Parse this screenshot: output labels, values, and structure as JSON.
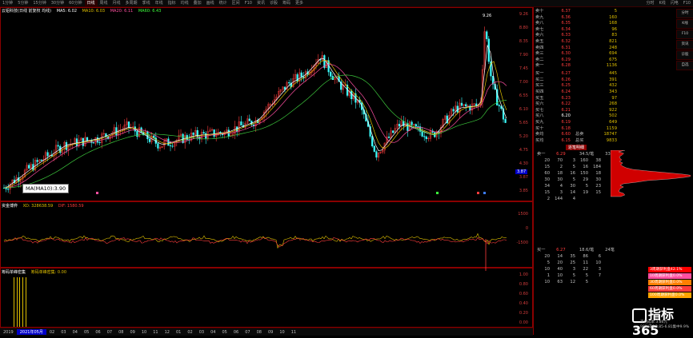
{
  "toolbar": {
    "items": [
      "1分钟",
      "5分钟",
      "15分钟",
      "30分钟",
      "60分钟",
      "日线",
      "周线",
      "月线",
      "多周期",
      "季线",
      "年线",
      "指标",
      "均线",
      "叠加",
      "画线",
      "统计",
      "区间",
      "F10",
      "资讯",
      "诊股",
      "筹码",
      "更多"
    ],
    "right_items": [
      "分时",
      "K线",
      "闪电",
      "F10"
    ]
  },
  "main_legend": {
    "title": "云铝科技(日线 前复权 均线)",
    "ma5": "MA5: 6.02",
    "ma10": "MA10: 6.03",
    "ma20": "MA20: 6.11",
    "ma60": "MA60: 6.43"
  },
  "price_axis": [
    "9.26",
    "8.80",
    "8.35",
    "7.90",
    "7.45",
    "7.00",
    "6.55",
    "6.10",
    "5.65",
    "5.20",
    "4.75",
    "4.30",
    "3.87",
    "3.85"
  ],
  "high_label": "9.26",
  "low_label": "3.87",
  "ma_tooltip": "MA(MA10):3.90",
  "osc_legend": {
    "title": "资金博弈",
    "line1": "XD: 328638.59",
    "line2": "DIF: 1580.59"
  },
  "osc_axis": [
    "1500",
    "0",
    "-1500"
  ],
  "volume_legend": {
    "title": "筹码单峰密集",
    "line1": "筹码单峰密集: 0.00"
  },
  "volume_axis": [
    "1.00",
    "0.80",
    "0.60",
    "0.40",
    "0.20",
    "0.00"
  ],
  "time_axis": [
    "2019",
    "2021年05月",
    "02",
    "03",
    "04",
    "05",
    "06",
    "07",
    "08",
    "09",
    "10",
    "11",
    "12",
    "01",
    "02",
    "03",
    "04",
    "05",
    "06",
    "07",
    "08",
    "09",
    "10",
    "11"
  ],
  "order_book": {
    "asks": [
      {
        "label": "卖十",
        "price": "6.37",
        "vol": "5"
      },
      {
        "label": "卖九",
        "price": "6.36",
        "vol": "160"
      },
      {
        "label": "卖八",
        "price": "6.35",
        "vol": "168"
      },
      {
        "label": "卖七",
        "price": "6.34",
        "vol": "96"
      },
      {
        "label": "卖六",
        "price": "6.33",
        "vol": "83"
      },
      {
        "label": "卖五",
        "price": "6.32",
        "vol": "821"
      },
      {
        "label": "卖四",
        "price": "6.31",
        "vol": "248"
      },
      {
        "label": "卖三",
        "price": "6.30",
        "vol": "694"
      },
      {
        "label": "卖二",
        "price": "6.29",
        "vol": "675"
      },
      {
        "label": "卖一",
        "price": "6.28",
        "vol": "1136"
      }
    ],
    "bids": [
      {
        "label": "买一",
        "price": "6.27",
        "vol": "445"
      },
      {
        "label": "买二",
        "price": "6.26",
        "vol": "391"
      },
      {
        "label": "买三",
        "price": "6.25",
        "vol": "432"
      },
      {
        "label": "买四",
        "price": "6.24",
        "vol": "343"
      },
      {
        "label": "买五",
        "price": "6.23",
        "vol": "97"
      },
      {
        "label": "买六",
        "price": "6.22",
        "vol": "268"
      },
      {
        "label": "买七",
        "price": "6.21",
        "vol": "922"
      },
      {
        "label": "买八",
        "price": "6.20",
        "vol": "502"
      },
      {
        "label": "买九",
        "price": "6.19",
        "vol": "649"
      },
      {
        "label": "买十",
        "price": "6.18",
        "vol": "1159"
      }
    ],
    "summary": [
      {
        "label": "卖均",
        "price": "6.60",
        "tag": "总卖",
        "vol": "18747"
      },
      {
        "label": "买均",
        "price": "6.15",
        "tag": "总买",
        "vol": "9833"
      }
    ]
  },
  "depth": {
    "title": "逐笔明细",
    "header": {
      "label": "卖一",
      "price": "6.29",
      "qty": "34.5/笔",
      "count": "33笔"
    },
    "rows": [
      [
        "20",
        "70",
        "3",
        "160",
        "38"
      ],
      [
        "15",
        "2",
        "5",
        "16",
        "184"
      ],
      [
        "60",
        "18",
        "16",
        "150",
        "18"
      ],
      [
        "30",
        "30",
        "5",
        "29",
        "30"
      ],
      [
        "34",
        "4",
        "30",
        "5",
        "23"
      ],
      [
        "15",
        "3",
        "14",
        "19",
        "15"
      ],
      [
        "2",
        "144",
        "4",
        "",
        ""
      ]
    ]
  },
  "bid_detail": {
    "header": {
      "label": "买一",
      "price": "6.27",
      "qty": "18.6/笔",
      "count": "24笔"
    },
    "rows": [
      [
        "20",
        "14",
        "35",
        "86",
        "6"
      ],
      [
        "5",
        "20",
        "25",
        "11",
        "10"
      ],
      [
        "10",
        "40",
        "3",
        "22",
        "3"
      ],
      [
        "1",
        "10",
        "5",
        "5",
        "7"
      ],
      [
        "10",
        "63",
        "12",
        "5",
        ""
      ]
    ]
  },
  "mini_legend": [
    {
      "label": "3周期获利盘42.1%",
      "color": "#ff0000"
    },
    {
      "label": "10周期获利盘0.0%",
      "color": "#ff4fa0"
    },
    {
      "label": "30周期获利盘0.0%",
      "color": "#ff7f00"
    },
    {
      "label": "60周期获利盘0.0%",
      "color": "#ff3c3c"
    },
    {
      "label": "100周期获利盘0.0%",
      "color": "#ffa500"
    }
  ],
  "brand": "指标365",
  "brand_sub": [
    "平均成本  3.86元",
    "90%成本3.85-6.81集中9.9%"
  ],
  "status": [
    "深证",
    "2021年05月",
    "指标365"
  ],
  "side_tabs": [
    "分时",
    "K线",
    "F10",
    "资讯",
    "诊股",
    "自选"
  ],
  "colors": {
    "up": "#ff3c3c",
    "down": "#3cff3c",
    "ma5": "#ffffff",
    "ma10": "#e0c000",
    "ma20": "#ff4fa0",
    "ma60": "#3cc63c",
    "border": "#8a0000"
  }
}
